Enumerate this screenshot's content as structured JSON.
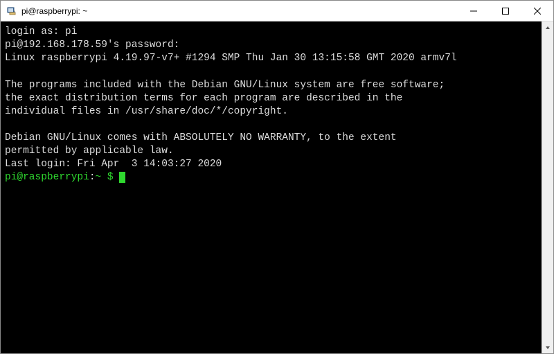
{
  "window": {
    "title": "pi@raspberrypi: ~"
  },
  "terminal": {
    "line1": "login as: pi",
    "line2": "pi@192.168.178.59's password:",
    "line3": "Linux raspberrypi 4.19.97-v7+ #1294 SMP Thu Jan 30 13:15:58 GMT 2020 armv7l",
    "line4": "",
    "line5": "The programs included with the Debian GNU/Linux system are free software;",
    "line6": "the exact distribution terms for each program are described in the",
    "line7": "individual files in /usr/share/doc/*/copyright.",
    "line8": "",
    "line9": "Debian GNU/Linux comes with ABSOLUTELY NO WARRANTY, to the extent",
    "line10": "permitted by applicable law.",
    "line11": "Last login: Fri Apr  3 14:03:27 2020",
    "prompt_user": "pi@raspberrypi",
    "prompt_sep": ":",
    "prompt_path": "~ $ "
  }
}
